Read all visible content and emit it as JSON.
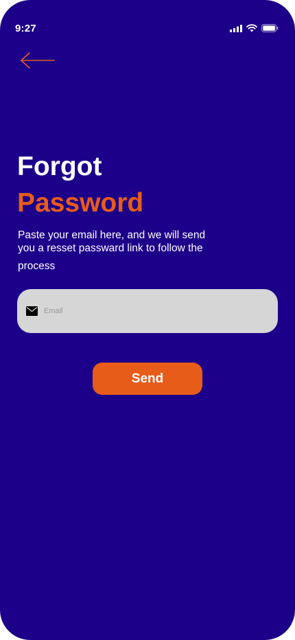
{
  "status_bar": {
    "time": "9:27",
    "icons": [
      "signal-icon",
      "wifi-icon",
      "battery-icon"
    ]
  },
  "nav": {
    "back_icon": "arrow-left-icon"
  },
  "title": {
    "line1": "Forgot",
    "line2": "Password"
  },
  "description": {
    "line1": "Paste your email here, and we will send",
    "line2": "you a resset passward link to follow the",
    "line3": "process"
  },
  "email": {
    "icon": "mail-icon",
    "placeholder": "Email",
    "value": ""
  },
  "send_button": {
    "label": "Send"
  },
  "colors": {
    "background": "#1C008A",
    "accent": "#E85C1A",
    "field_bg": "#D6D6D6",
    "text": "#FFFFFF"
  }
}
